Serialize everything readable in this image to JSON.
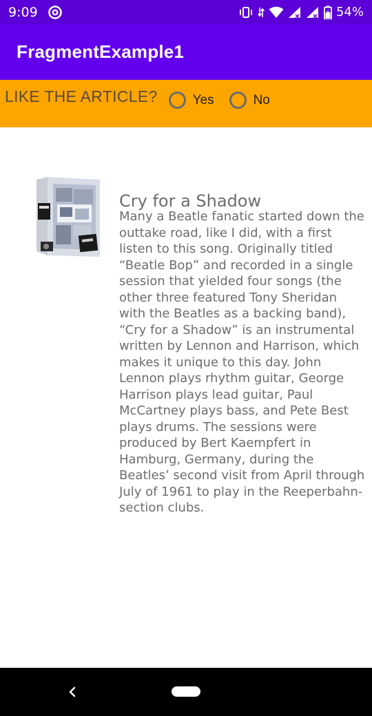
{
  "status_bar": {
    "time": "9:09",
    "battery": "54%",
    "icons": [
      "at-sign-icon",
      "vibrate-icon",
      "data-arrows-icon",
      "wifi-icon",
      "signal-icon",
      "signal-icon",
      "battery-icon"
    ]
  },
  "app_bar": {
    "title": "FragmentExample1"
  },
  "rating": {
    "question": "LIKE THE ARTICLE?",
    "options": [
      {
        "label": "Yes",
        "checked": false
      },
      {
        "label": "No",
        "checked": false
      }
    ]
  },
  "article": {
    "title": "Cry for a Shadow",
    "image_label": "The Beatles anthology box set cover",
    "body": "Many a Beatle fanatic started down the outtake road, like I did, with a first listen to this song. Originally titled “Beatle Bop” and recorded in a single session that yielded four songs (the other three featured Tony Sheridan with the Beatles as a backing band), “Cry for a Shadow” is an instrumental written by Lennon and Harrison, which makes it unique to this day. John Lennon plays rhythm guitar, George Harrison plays lead guitar, Paul McCartney plays bass, and Pete Best plays drums. The sessions were produced by Bert Kaempfert in Hamburg, Germany, during the Beatles’ second visit from April through July of 1961 to play in the Reeperbahn-section clubs."
  },
  "colors": {
    "status_bar": "#5b00d6",
    "app_bar": "#6200ee",
    "rating_bar": "#ffa500",
    "text_gray": "#6d6d6d",
    "nav_bar": "#000000"
  }
}
